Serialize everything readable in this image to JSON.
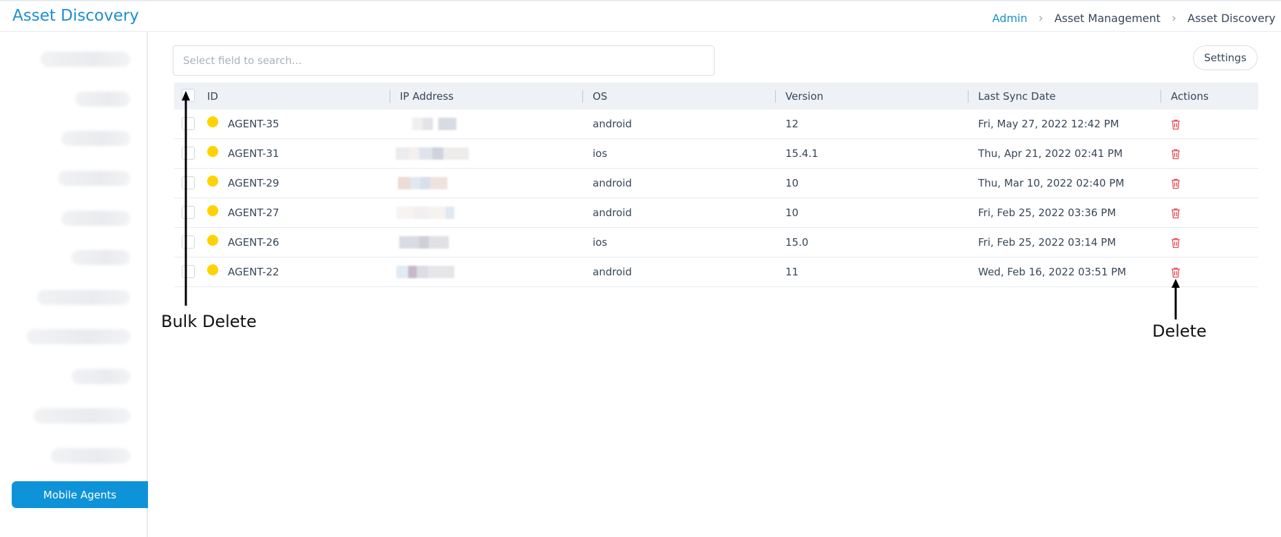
{
  "header": {
    "title": "Asset Discovery",
    "breadcrumb": [
      "Admin",
      "Asset Management",
      "Asset Discovery"
    ]
  },
  "sidebar": {
    "active_item": "Mobile Agents",
    "accent_color": "#0f93d8"
  },
  "search": {
    "placeholder": "Select field to search..."
  },
  "toolbar": {
    "settings_label": "Settings"
  },
  "grid": {
    "columns": [
      "ID",
      "IP Address",
      "OS",
      "Version",
      "Last Sync Date",
      "Actions"
    ],
    "rows": [
      {
        "id": "AGENT-35",
        "os": "android",
        "version": "12",
        "last_sync": "Fri, May 27, 2022 12:42 PM"
      },
      {
        "id": "AGENT-31",
        "os": "ios",
        "version": "15.4.1",
        "last_sync": "Thu, Apr 21, 2022 02:41 PM"
      },
      {
        "id": "AGENT-29",
        "os": "android",
        "version": "10",
        "last_sync": "Thu, Mar 10, 2022 02:40 PM"
      },
      {
        "id": "AGENT-27",
        "os": "android",
        "version": "10",
        "last_sync": "Fri, Feb 25, 2022 03:36 PM"
      },
      {
        "id": "AGENT-26",
        "os": "ios",
        "version": "15.0",
        "last_sync": "Fri, Feb 25, 2022 03:14 PM"
      },
      {
        "id": "AGENT-22",
        "os": "android",
        "version": "11",
        "last_sync": "Wed, Feb 16, 2022 03:51 PM"
      }
    ],
    "status_color": "#ffd200",
    "delete_color": "#e5484d"
  },
  "annotations": {
    "bulk_delete": "Bulk Delete",
    "delete": "Delete"
  }
}
